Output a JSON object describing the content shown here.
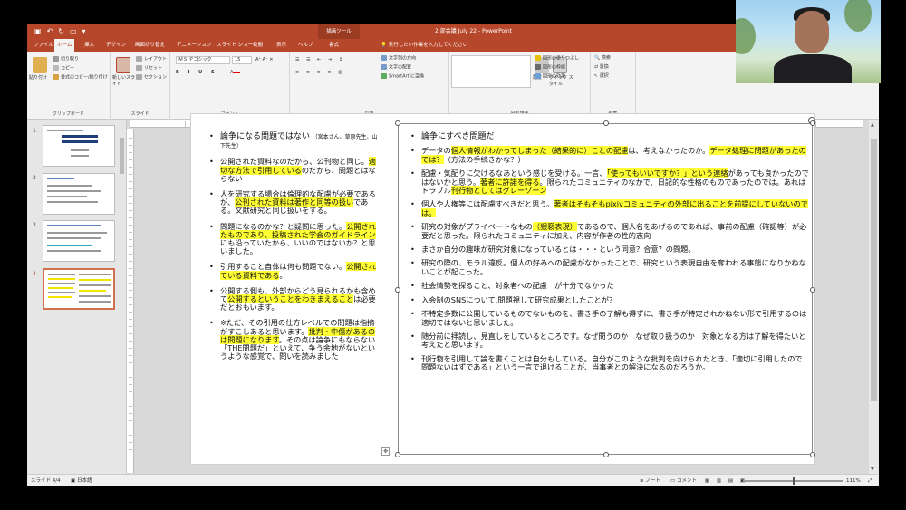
{
  "window": {
    "title": "2 部会議 July 22 - PowerPoint",
    "context_tool": "描画ツール"
  },
  "tabs": [
    "ファイル",
    "ホーム",
    "挿入",
    "デザイン",
    "画面切り替え",
    "アニメーション",
    "スライド ショー",
    "校閲",
    "表示",
    "ヘルプ",
    "書式"
  ],
  "active_tab": "ホーム",
  "tell_me": "実行したい作業を入力してください",
  "ribbon": {
    "clipboard": {
      "paste": "貼り付け",
      "cut": "切り取り",
      "copy": "コピー",
      "format_painter": "書式のコピー/貼り付け",
      "label": "クリップボード"
    },
    "slides": {
      "new_slide": "新しいスライド",
      "layout": "レイアウト",
      "reset": "リセット",
      "section": "セクション",
      "label": "スライド"
    },
    "font": {
      "font_name": "ＭＳ Ｐゴシック",
      "font_size": "15",
      "label": "フォント"
    },
    "paragraph": {
      "text_direction": "文字列の方向",
      "align_text": "文字の配置",
      "smartart": "SmartArt に変換",
      "label": "段落"
    },
    "drawing": {
      "arrange": "配置",
      "quick_styles": "クイック スタイル",
      "fill": "図形の塗りつぶし",
      "outline": "図形の枠線",
      "effects": "図形の効果",
      "label": "図形描画"
    },
    "editing": {
      "find": "検索",
      "replace": "置換",
      "select": "選択",
      "label": "編集"
    }
  },
  "slide_panel": {
    "numbers": [
      "1",
      "2",
      "3",
      "4"
    ],
    "selected": "4"
  },
  "slide": {
    "left": {
      "b1_main": "論争になる問題ではない",
      "b1_small": "（宮本さん、草原先生、山下先生）",
      "b2_a": "公開された資料なのだから、公刊物と同じ。",
      "b2_hl": "適切な方法で引用している",
      "b2_b": "のだから、問題とはならない",
      "b3_a": "人を研究する場合は倫理的な配慮が必要であるが、",
      "b3_hl": "公刊された資料は著作と同等の扱い",
      "b3_b": "である。文献研究と同じ扱いをする。",
      "b4_a": "問題になるのかな？と疑問に思った。",
      "b4_hl": "公開されたものであり、投稿された学会のガイドライン",
      "b4_b": "にも沿っていたから、いいのではないか？と思いました。",
      "b5_a": "引用すること自体は何も問題でない。",
      "b5_hl": "公開されている資料である",
      "b5_b": "。",
      "b6_a": "公開する側も、外部からどう見られるかも含めて",
      "b6_hl": "公開するということをわきまえること",
      "b6_b": "は必要だとおもいます。",
      "b7_a": "※ただ、その引用の仕方レベルでの問題は指摘がすこしあると思います。",
      "b7_hl": "批判・中傷があるのは問題になります",
      "b7_b": "。その点は論争にもならない「THE問題だ」といえて、争う余地がないというような感覚で、問いを読みました"
    },
    "right": {
      "heading": "論争にすべき問題だ",
      "r1_a": "データの",
      "r1_hl1": "個人情報がわかってしまった（結果的に）ことの配慮",
      "r1_b": "は、考えなかったのか。",
      "r1_hl2": "データ処理に問題があったのでは？",
      "r1_c": "（方法の手続きかな？）",
      "r2_a": "配慮・気配りに欠けるなあという感じを受ける。一言、",
      "r2_hl1": "「使ってもいいですか？」という連絡",
      "r2_b": "があっても良かったのではないかと思う。",
      "r2_hl2": "著者に許諾を得る",
      "r2_c": "。限られたコミュニティのなかで、日記的な性格のものであったのでは。あれはトラブル",
      "r2_hl3": "刊行物としてはグレーゾーン",
      "r3_a": "個人や人権等には配慮すべきだと思う。",
      "r3_hl": "著者はそもそもpixivコミュニティの外部に出ることを前提にしていないのでは。",
      "r4_a": "研究の対象がプライベートなもの",
      "r4_hl": "（猥褻表現）",
      "r4_b": "であるので、個人名をあげるのであれば、事前の配慮（確認等）が必要だと思った。限られたコミュニティに加え、内容が作者の性的志向",
      "r5": "まさか自分の趣味が研究対象になっているとは・・・という同意？合意？の問題。",
      "r6": "研究の際の、モラル違反。個人の好みへの配慮がなかったことで、研究という表現自由を奪われる事態になりかねないことが起こった。",
      "r7": "社会情勢を探ること、対象者への配慮　が十分でなかった",
      "r8": "入会制のSNSについて,問題視して研究成果としたことが？",
      "r9": "不特定多数に公開しているものでないものを、書き手の了解も得ずに、書き手が特定されかねない形で引用するのは適切ではないと思いました。",
      "r10": "随分前に拝読し、見直しをしているところです。なぜ問うのか　なぜ取り扱うのか　対象となる方は了解を得たいと考えたと思います。",
      "r11": "刊行物を引用して論を書くことは自分もしている。自分がこのような批判を向けられたとき、「適切に引用したので問題ないはずである」という一言で退けることが、当事者との解決になるのだろうか。"
    }
  },
  "status": {
    "slide_info": "スライド 4/4",
    "language": "日本語",
    "notes": "ノート",
    "comments": "コメント",
    "zoom": "111%"
  }
}
